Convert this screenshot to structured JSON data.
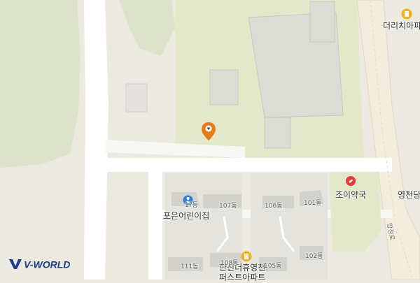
{
  "map": {
    "colors": {
      "forest": "#dfe5cf",
      "green_area": "#e0e6c8",
      "road": "#ffffff",
      "building": "#dcdcd6",
      "residential": "#e6e4dd",
      "major_road": "#f5ecd3"
    },
    "labels": {
      "apartment_top": "더리치아파",
      "pharmacy": "조이약국",
      "yeongcheon": "영천당",
      "daycare": "포은어린이집",
      "apartment_bottom_1": "한신더휴영천",
      "apartment_bottom_2": "퍼스트아파트",
      "road_name": "망정로"
    },
    "buildings": {
      "b107": "107동",
      "b106": "106동",
      "b101": "101동",
      "b102": "102동",
      "b105": "105동",
      "b108": "108동",
      "b111": "111동",
      "b112": "1?동"
    },
    "icons": {
      "location_pin": "orange-location-pin-icon",
      "pharmacy": "pharmacy-icon",
      "daycare": "daycare-icon",
      "apartment": "apartment-icon"
    }
  },
  "logo": {
    "text": "V-WORLD"
  }
}
